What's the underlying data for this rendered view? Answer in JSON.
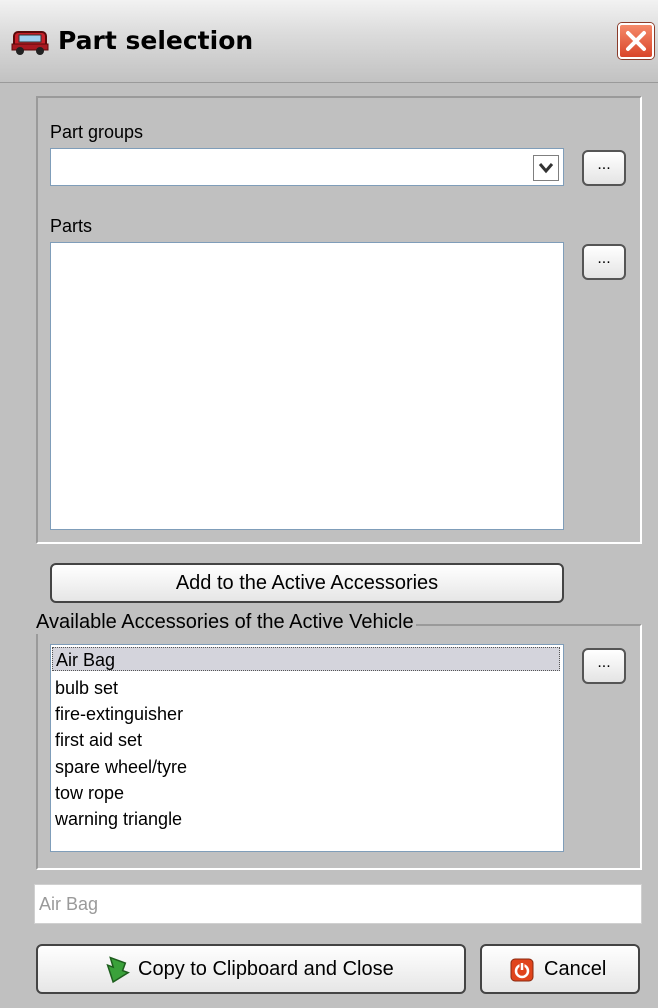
{
  "window": {
    "title": "Part selection",
    "close_icon": "close-icon",
    "app_icon": "car-icon"
  },
  "part_groups": {
    "label": "Part groups",
    "value": "",
    "browse_label": "..."
  },
  "parts": {
    "label": "Parts",
    "items": [],
    "browse_label": "..."
  },
  "add_button": {
    "label": "Add to the Active Accessories"
  },
  "accessories": {
    "legend": "Available Accessories of the Active Vehicle",
    "items": [
      "Air Bag",
      "bulb set",
      "fire-extinguisher",
      "first aid set",
      "spare wheel/tyre",
      "tow rope",
      "warning triangle"
    ],
    "selected": "Air Bag",
    "browse_label": "..."
  },
  "selection_field": {
    "value": "Air Bag"
  },
  "footer": {
    "copy_label": "Copy to Clipboard and Close",
    "copy_icon": "arrow-icon",
    "cancel_label": "Cancel",
    "cancel_icon": "power-icon"
  },
  "colors": {
    "accent_close": "#d9452a",
    "arrow_green": "#3aa13a",
    "cancel_orange": "#e0441c"
  }
}
